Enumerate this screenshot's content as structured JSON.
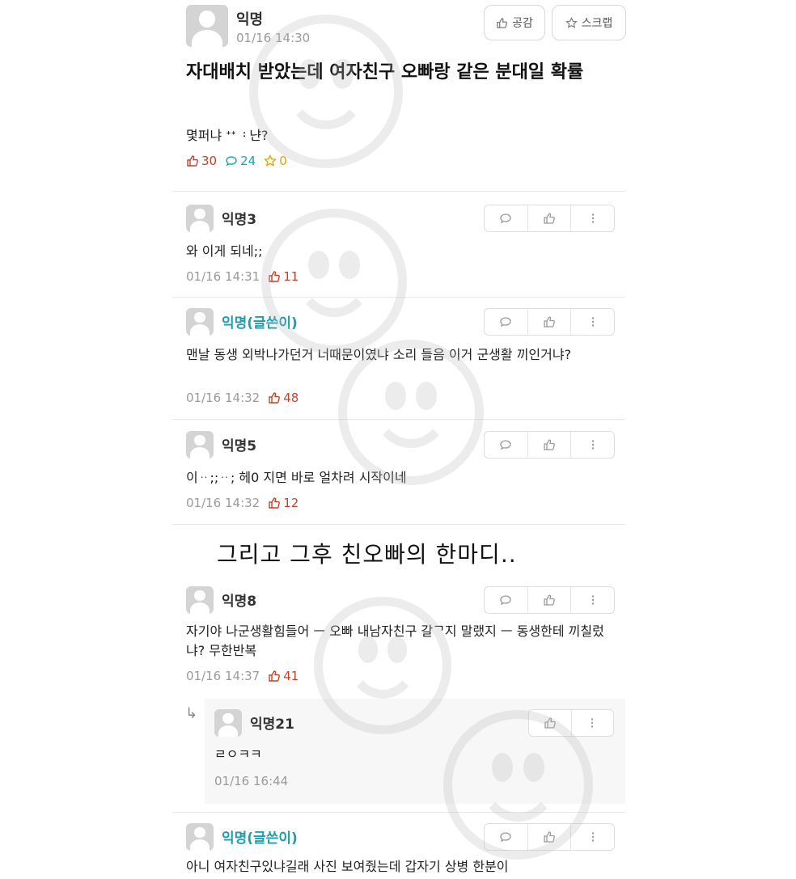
{
  "post": {
    "author": "익명",
    "time": "01/16 14:30",
    "like_button": "공감",
    "scrap_button": "스크랩",
    "title": "자대배치 받았는데 여자친구 오빠랑 같은 분대일 확률",
    "body": "몇퍼냐 ᐩᐩ ᠄ 냔?",
    "likes": "30",
    "comments": "24",
    "scraps": "0"
  },
  "comments": [
    {
      "author": "익명3",
      "text": "와 이게 되네;;",
      "time": "01/16 14:31",
      "likes": "11",
      "op": false
    },
    {
      "author": "익명(글쓴이)",
      "text": "맨날 동생 외박나가던거 너때문이였냐 소리 들음 이거 군생활 끼인거냐?",
      "time": "01/16 14:32",
      "likes": "48",
      "op": true
    },
    {
      "author": "익명5",
      "text": "이ᆢ;;ᆢ; 헤0 지면 바로 얼차려 시작이네",
      "time": "01/16 14:32",
      "likes": "12",
      "op": false
    },
    {
      "author": "익명8",
      "text": "자기야 나군생활힘들어 ㅡ 오빠 내남자친구 갈ᄀ지 말랬지 ㅡ 동생한테 끼칠렀냐? 무한반복",
      "time": "01/16 14:37",
      "likes": "41",
      "op": false
    },
    {
      "author": "익명(글쓴이)",
      "text": "아니 여자친구있냐길래 사진 보여줬는데 갑자기 상병 한분이",
      "op": true
    }
  ],
  "reply": {
    "author": "익명21",
    "text": "ㄹㅇㅋㅋ",
    "time": "01/16 16:44"
  },
  "banner": "그리고 그후 친오빠의 한마디..",
  "colors": {
    "like": "#c0442d",
    "comment": "#1aa3b6",
    "scrap": "#d7a400",
    "op_name": "#1d9eb0"
  },
  "icons": [
    "thumbs-up-icon",
    "star-icon",
    "speech-bubble-icon",
    "more-vertical-icon",
    "reply-arrow-icon"
  ]
}
